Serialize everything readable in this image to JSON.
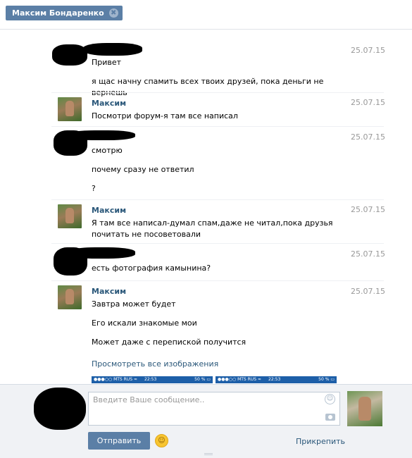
{
  "window": {
    "tab_title": "Максим Бондаренко",
    "close_glyph": "✖"
  },
  "messages": [
    {
      "author": "",
      "date": "25.07.15",
      "lines": [
        "Привет",
        "я щас начну спамить всех твоих друзей, пока деньги не вернешь"
      ]
    },
    {
      "author": "Максим",
      "date": "25.07.15",
      "lines": [
        "Посмотри форум-я там все написал"
      ]
    },
    {
      "author": "",
      "date": "25.07.15",
      "lines": [
        "смотрю",
        "почему сразу не ответил",
        "?"
      ]
    },
    {
      "author": "Максим",
      "date": "25.07.15",
      "lines": [
        "Я там все написал-думал спам,даже не читал,пока друзья почитать не посоветовали"
      ]
    },
    {
      "author": "",
      "date": "25.07.15",
      "lines": [
        "есть фотография камынина?"
      ]
    },
    {
      "author": "Максим",
      "date": "25.07.15",
      "lines": [
        "Завтра может будет",
        "Его искали знакомые мои",
        "Может даже с перепиской получится"
      ]
    }
  ],
  "attachments": {
    "view_all_label": "Просмотреть все изображения",
    "thumbs": [
      {
        "carrier": "●●●○○ MTS RUS ≈",
        "time": "22:53",
        "battery": "50 % ▭"
      },
      {
        "carrier": "●●●○○ MTS RUS ≈",
        "time": "22:53",
        "battery": "50 % ▭"
      }
    ]
  },
  "composer": {
    "placeholder": "Введите Ваше сообщение..",
    "send_label": "Отправить",
    "attach_label": "Прикрепить",
    "smile_glyph": "☺",
    "emoji_glyph": "☺"
  },
  "icons": [
    "close-icon",
    "smile-icon",
    "camera-icon",
    "emoji-icon"
  ],
  "colors": {
    "accent": "#5b7fa6",
    "link": "#2b587a",
    "date": "#999999",
    "composer_bg": "#f0f2f5"
  }
}
